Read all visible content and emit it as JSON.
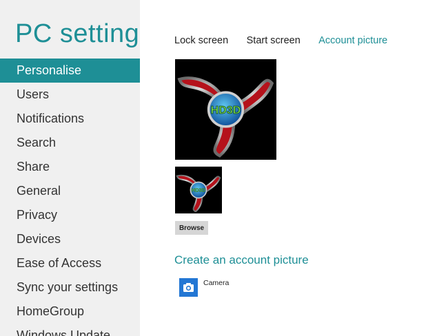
{
  "app": {
    "title": "PC settings"
  },
  "sidebar": {
    "items": [
      {
        "label": "Personalise",
        "active": true
      },
      {
        "label": "Users"
      },
      {
        "label": "Notifications"
      },
      {
        "label": "Search"
      },
      {
        "label": "Share"
      },
      {
        "label": "General"
      },
      {
        "label": "Privacy"
      },
      {
        "label": "Devices"
      },
      {
        "label": "Ease of Access"
      },
      {
        "label": "Sync your settings"
      },
      {
        "label": "HomeGroup"
      },
      {
        "label": "Windows Update"
      }
    ]
  },
  "tabs": [
    {
      "label": "Lock screen"
    },
    {
      "label": "Start screen"
    },
    {
      "label": "Account picture",
      "active": true
    }
  ],
  "account_picture": {
    "logo_text": "HD3D",
    "browse_label": "Browse"
  },
  "create": {
    "heading": "Create an account picture",
    "apps": [
      {
        "label": "Camera",
        "icon": "camera-icon"
      }
    ]
  },
  "colors": {
    "accent": "#1e8f96",
    "sidebar_bg": "#f0f0f0",
    "camera_tile": "#2377d4"
  }
}
